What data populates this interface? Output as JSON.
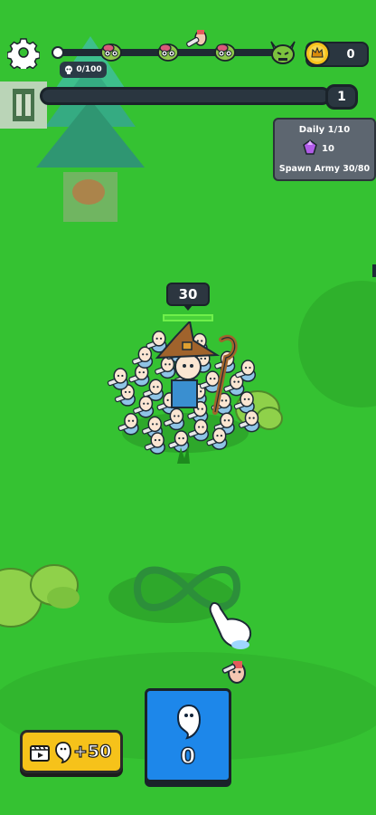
{
  "hud": {
    "kill_counter": "0/100",
    "coins": "0",
    "level": "1",
    "icons": {
      "settings": "gear-icon",
      "kills": "skull-icon",
      "coins": "crown-coin-icon",
      "wave_markers": [
        "zombie-head-icon",
        "zombie-head-icon",
        "zombie-head-icon",
        "horned-boss-icon"
      ]
    }
  },
  "daily": {
    "title": "Daily 1/10",
    "gem_reward": "10",
    "task": "Spawn Army 30/80",
    "gem_icon": "purple-gem-icon"
  },
  "army": {
    "count": "30",
    "health_fraction": 1.0
  },
  "actions": {
    "ad_reward_label": "+50",
    "spawn_count": "0",
    "ad_icon": "video-ad-icon",
    "spawn_icon": "ghost-icon"
  },
  "tutorial": {
    "gesture": "infinity-swipe-hint",
    "hand_icon": "pointing-hand-icon"
  },
  "colors": {
    "grass": "#35c232",
    "tree": "#2fa89a",
    "bush": "#8fd14a",
    "hud_dark": "#2a3640",
    "ad_button": "#f6c21a",
    "spawn_card": "#1d87ea",
    "health": "#6ff04a"
  }
}
